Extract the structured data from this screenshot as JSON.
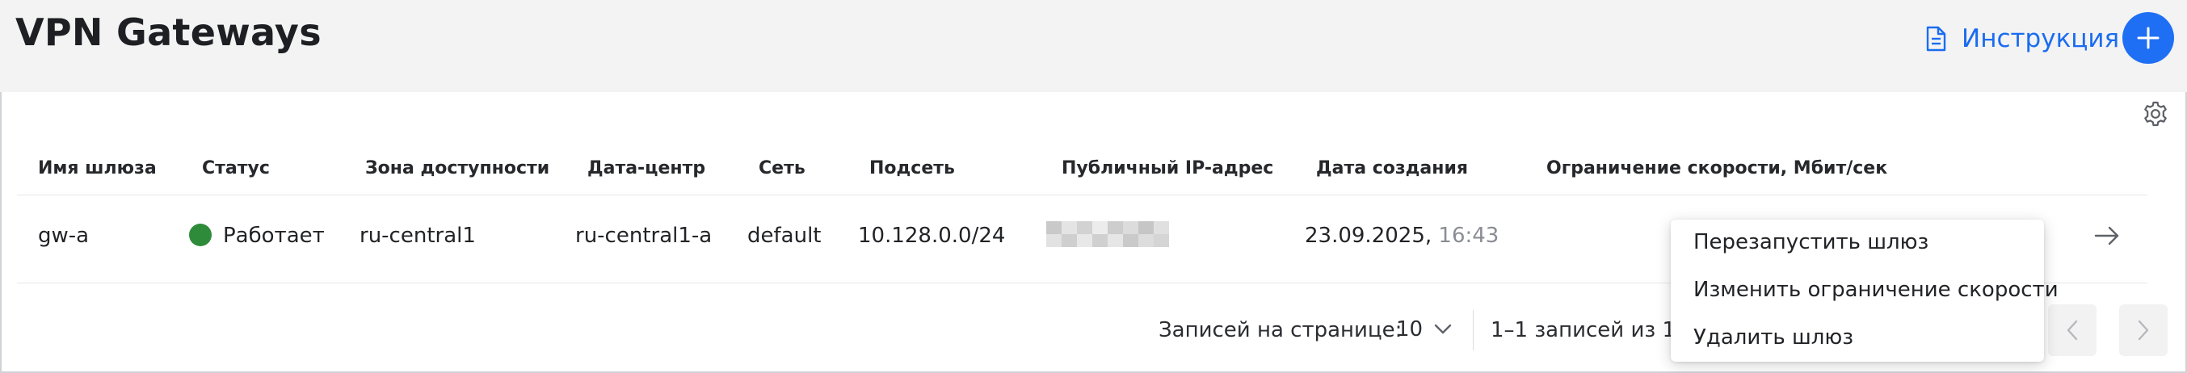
{
  "header": {
    "title": "VPN Gateways",
    "instruction_label": "Инструкция",
    "add_icon": "plus-icon",
    "instruction_icon": "document-icon"
  },
  "table": {
    "settings_icon": "gear-icon",
    "columns": [
      "Имя шлюза",
      "Статус",
      "Зона доступности",
      "Дата-центр",
      "Сеть",
      "Подсеть",
      "Публичный IP-адрес",
      "Дата создания",
      "Ограничение скорости, Мбит/сек"
    ],
    "rows": [
      {
        "name": "gw-a",
        "status": "Работает",
        "status_color": "#2e8b3a",
        "zone": "ru-central1",
        "datacenter": "ru-central1-a",
        "network": "default",
        "subnet": "10.128.0.0/24",
        "public_ip": "",
        "created_date": "23.09.2025,",
        "created_time": "16:43",
        "speed_limit": ""
      }
    ]
  },
  "pagination": {
    "per_page_label": "Записей на странице:",
    "per_page_value": "10",
    "range_label": "1–1 записей из 1"
  },
  "context_menu": {
    "items": [
      "Перезапустить шлюз",
      "Изменить ограничение скорости",
      "Удалить шлюз"
    ]
  },
  "colors": {
    "accent": "#1f6ff5",
    "link": "#1a6cf0",
    "header_bg": "#f3f3f4",
    "status_ok": "#2e8b3a"
  }
}
